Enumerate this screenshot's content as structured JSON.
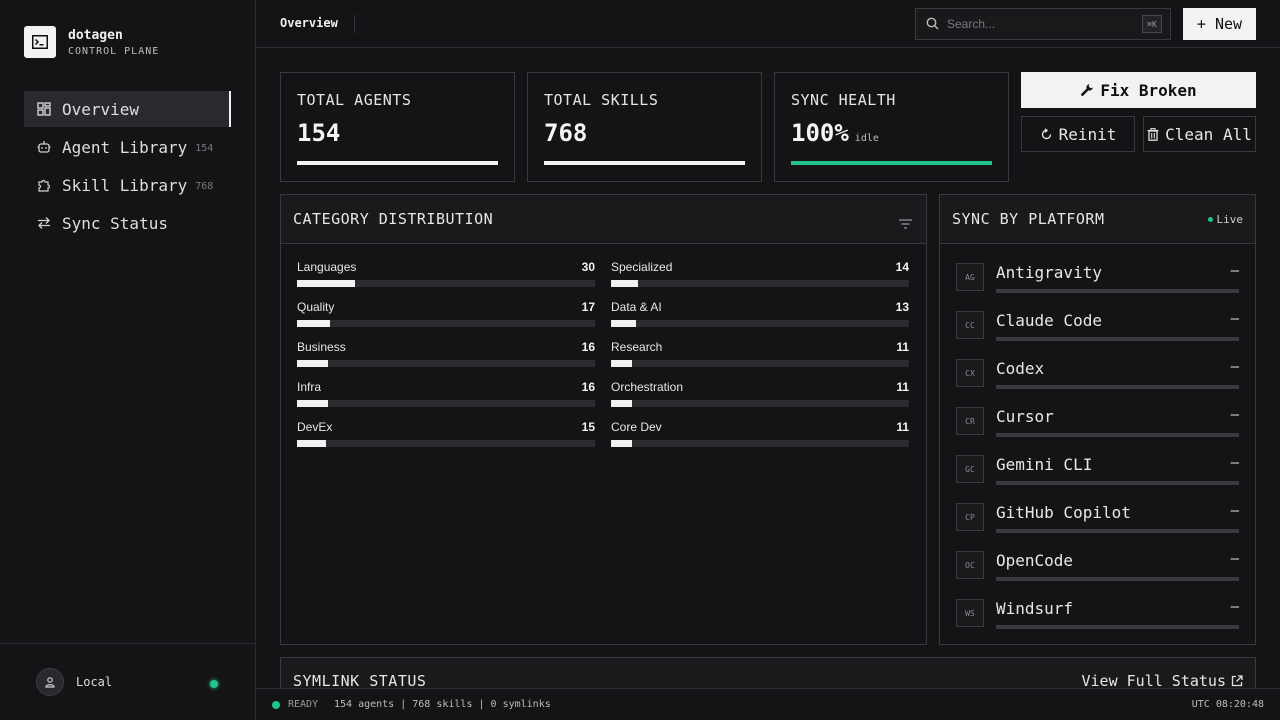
{
  "brand": {
    "name": "dotagen",
    "subtitle": "CONTROL PLANE"
  },
  "sidebar": {
    "items": [
      {
        "label": "Overview",
        "count": "",
        "icon": "dashboard-icon",
        "active": true
      },
      {
        "label": "Agent Library",
        "count": "154",
        "icon": "robot-icon",
        "active": false
      },
      {
        "label": "Skill Library",
        "count": "768",
        "icon": "puzzle-icon",
        "active": false
      },
      {
        "label": "Sync Status",
        "count": "",
        "icon": "arrows-swap-icon",
        "active": false
      }
    ],
    "footer": {
      "label": "Local",
      "status_color": "#22c38e"
    }
  },
  "header": {
    "title": "Overview",
    "search_placeholder": "Search...",
    "search_shortcut": "⌘K",
    "new_label": "+ New"
  },
  "stats": [
    {
      "label": "TOTAL AGENTS",
      "value": "154",
      "sub": "",
      "fill": 1.0,
      "color": "#f2f2f2"
    },
    {
      "label": "TOTAL SKILLS",
      "value": "768",
      "sub": "",
      "fill": 1.0,
      "color": "#f2f2f2"
    },
    {
      "label": "SYNC HEALTH",
      "value": "100%",
      "sub": "idle",
      "fill": 1.0,
      "color": "#22c38e"
    }
  ],
  "actions": {
    "fix_label": "Fix Broken",
    "reinit_label": "Reinit",
    "clean_label": "Clean All"
  },
  "category": {
    "title": "CATEGORY DISTRIBUTION",
    "max": 154,
    "items": [
      {
        "name": "Languages",
        "value": 30
      },
      {
        "name": "Specialized",
        "value": 14
      },
      {
        "name": "Quality",
        "value": 17
      },
      {
        "name": "Data & AI",
        "value": 13
      },
      {
        "name": "Business",
        "value": 16
      },
      {
        "name": "Research",
        "value": 11
      },
      {
        "name": "Infra",
        "value": 16
      },
      {
        "name": "Orchestration",
        "value": 11
      },
      {
        "name": "DevEx",
        "value": 15
      },
      {
        "name": "Core Dev",
        "value": 11
      }
    ]
  },
  "platforms": {
    "title": "SYNC BY PLATFORM",
    "live_label": "Live",
    "items": [
      {
        "code": "AG",
        "name": "Antigravity",
        "value": "—"
      },
      {
        "code": "CC",
        "name": "Claude Code",
        "value": "—"
      },
      {
        "code": "CX",
        "name": "Codex",
        "value": "—"
      },
      {
        "code": "CR",
        "name": "Cursor",
        "value": "—"
      },
      {
        "code": "GC",
        "name": "Gemini CLI",
        "value": "—"
      },
      {
        "code": "CP",
        "name": "GitHub Copilot",
        "value": "—"
      },
      {
        "code": "OC",
        "name": "OpenCode",
        "value": "—"
      },
      {
        "code": "WS",
        "name": "Windsurf",
        "value": "—"
      }
    ]
  },
  "symlink": {
    "title": "SYMLINK STATUS",
    "link_label": "View Full Status"
  },
  "statusbar": {
    "ready": "READY",
    "info": "154 agents | 768 skills | 0 symlinks",
    "time": "UTC 08:20:48"
  },
  "colors": {
    "accent": "#f2f2f2",
    "success": "#22c38e",
    "background": "#141416",
    "border": "#3a3a3e"
  }
}
